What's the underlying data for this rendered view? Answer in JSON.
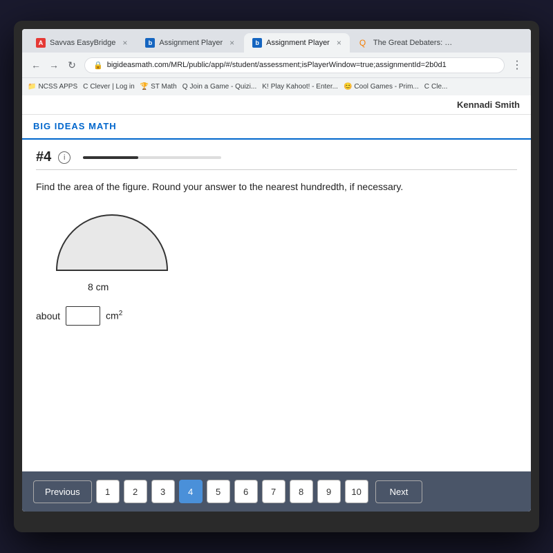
{
  "browser": {
    "tabs": [
      {
        "id": "tab1",
        "label": "Savvas EasyBridge",
        "active": false,
        "icon": "A"
      },
      {
        "id": "tab2",
        "label": "Assignment Player",
        "active": false,
        "icon": "b"
      },
      {
        "id": "tab3",
        "label": "Assignment Player",
        "active": true,
        "icon": "b"
      },
      {
        "id": "tab4",
        "label": "The Great Debaters: Mo",
        "active": false,
        "icon": "Q"
      }
    ],
    "address": "bigideasmath.com/MRL/public/app/#/student/assessment;isPlayerWindow=true;assignmentId=2b0d1",
    "bookmarks": [
      "NCSS APPS",
      "Clever | Log in",
      "ST Math",
      "Join a Game - Quizi...",
      "Play Kahoot! - Enter...",
      "Cool Games - Prim...",
      "Cle..."
    ]
  },
  "header": {
    "user_name": "Kennadi Smith"
  },
  "site": {
    "title": "BIG IDEAS MATH"
  },
  "question": {
    "number": "#4",
    "progress_percent": 40,
    "text": "Find the area of the figure. Round your answer to the nearest hundredth, if necessary.",
    "figure": {
      "type": "semicircle",
      "diameter_label": "8 cm",
      "diameter_value": 8
    },
    "answer": {
      "prefix": "about",
      "unit": "cm",
      "unit_exp": "2",
      "placeholder": ""
    }
  },
  "navigation": {
    "previous_label": "Previous",
    "next_label": "Next",
    "pages": [
      "1",
      "2",
      "3",
      "4",
      "5",
      "6",
      "7",
      "8",
      "9",
      "10"
    ],
    "current_page": 4
  }
}
